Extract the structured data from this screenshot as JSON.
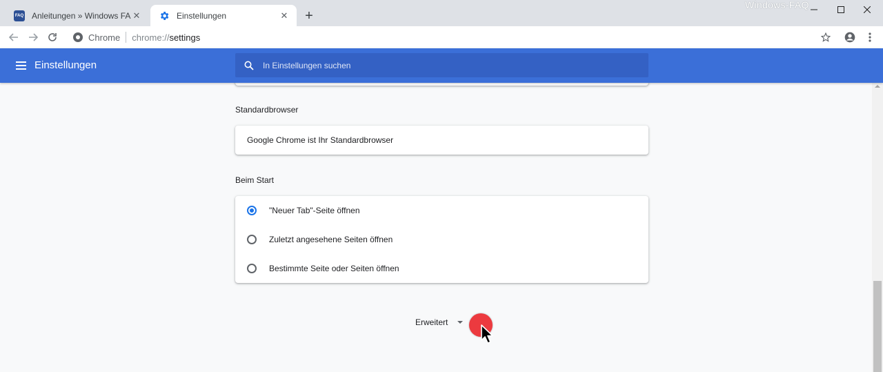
{
  "watermark": "Windows-FAQ",
  "tabs": [
    {
      "title": "Anleitungen » Windows FAQ",
      "favicon": "FAQ",
      "active": false
    },
    {
      "title": "Einstellungen",
      "active": true
    }
  ],
  "new_tab_label": "+",
  "omnibox": {
    "chip": "Chrome",
    "scheme": "chrome://",
    "host": "settings"
  },
  "header": {
    "title": "Einstellungen",
    "search_placeholder": "In Einstellungen suchen"
  },
  "sections": {
    "default_browser": {
      "title": "Standardbrowser",
      "status": "Google Chrome ist Ihr Standardbrowser"
    },
    "on_startup": {
      "title": "Beim Start",
      "options": [
        {
          "label": "\"Neuer Tab\"-Seite öffnen",
          "checked": true
        },
        {
          "label": "Zuletzt angesehene Seiten öffnen",
          "checked": false
        },
        {
          "label": "Bestimmte Seite oder Seiten öffnen",
          "checked": false
        }
      ]
    }
  },
  "advanced_label": "Erweitert",
  "colors": {
    "header": "#3b6fd8",
    "search": "#3461c4",
    "accent": "#1a73e8",
    "click_marker": "#ec3a3f"
  },
  "icons": [
    "faq-favicon",
    "gear-icon",
    "close-icon",
    "plus-icon",
    "back-icon",
    "forward-icon",
    "reload-icon",
    "chrome-icon",
    "star-icon",
    "account-icon",
    "more-icon",
    "menu-icon",
    "search-icon",
    "chevron-down-icon",
    "cursor-icon"
  ]
}
